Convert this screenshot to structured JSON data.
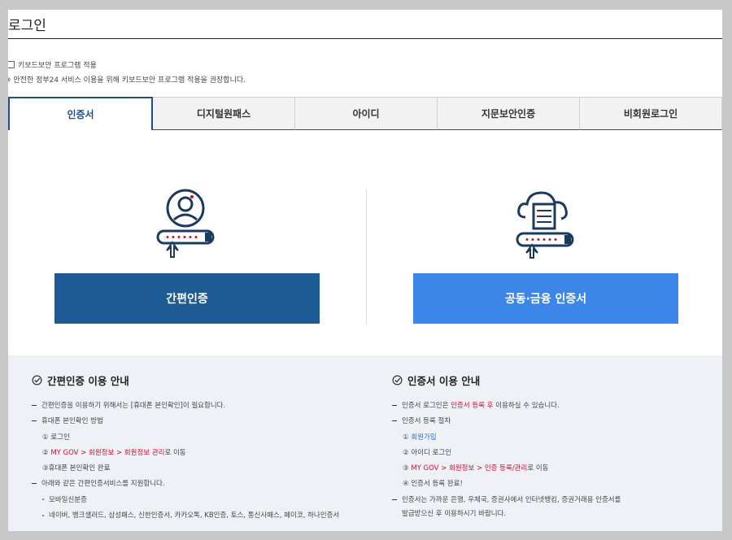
{
  "page": {
    "title": "로그인"
  },
  "security": {
    "checkbox_label": "키보드보안 프로그램 적용",
    "notice": "※ 안전한 정부24 서비스 이용을 위해 키보드보안 프로그램 적용을 권장합니다."
  },
  "tabs": [
    {
      "label": "인증서"
    },
    {
      "label": "디지털원패스"
    },
    {
      "label": "아이디"
    },
    {
      "label": "지문보안인증"
    },
    {
      "label": "비회원로그인"
    }
  ],
  "login": {
    "simple_button": "간편인증",
    "cert_button": "공동·금융 인증서"
  },
  "guide_simple": {
    "title": "간편인증 이용 안내",
    "l1": "간편인증을 이용하기 위해서는 [휴대폰 본인확인]이 필요합니다.",
    "l2": "휴대폰 본인확인 방법",
    "s1_num": "①",
    "s1": "로그인",
    "s2_num": "②",
    "s2_red": "MY GOV > 회원정보 > 회원정보 관리",
    "s2_rest": "로 이동",
    "s3_num": "③",
    "s3": "휴대폰 본인확인 완료",
    "l3": "아래와 같은 간편인증서비스를 지원합니다.",
    "b1": "모바일신분증",
    "b2": "네이버, 뱅크샐러드, 삼성패스, 신한인증서, 카카오톡, KB인증, 토스, 통신사패스, 페이코, 하나인증서"
  },
  "guide_cert": {
    "title": "인증서 이용 안내",
    "l1_a": "인증서 로그인은 ",
    "l1_red": "인증서 등록 후",
    "l1_b": " 이용하실 수 있습니다.",
    "l2": "인증서 등록 절차",
    "s1_num": "①",
    "s1": "회원가입",
    "s2_num": "②",
    "s2": "아이디 로그인",
    "s3_num": "③",
    "s3_red": "MY GOV > 회원정보 > 인증 등록/관리",
    "s3_rest": "로 이동",
    "s4_num": "④",
    "s4": "인증서 등록 완료!",
    "l3": "인증서는 가까운 은행, 우체국, 증권사에서 인터넷뱅킹, 증권거래용 인증서를",
    "l3b": "발급받으신 후 이용하시기 바랍니다."
  },
  "colors": {
    "primary": "#1e5a94",
    "secondary": "#3b86e6",
    "accent_red": "#c8102e"
  }
}
